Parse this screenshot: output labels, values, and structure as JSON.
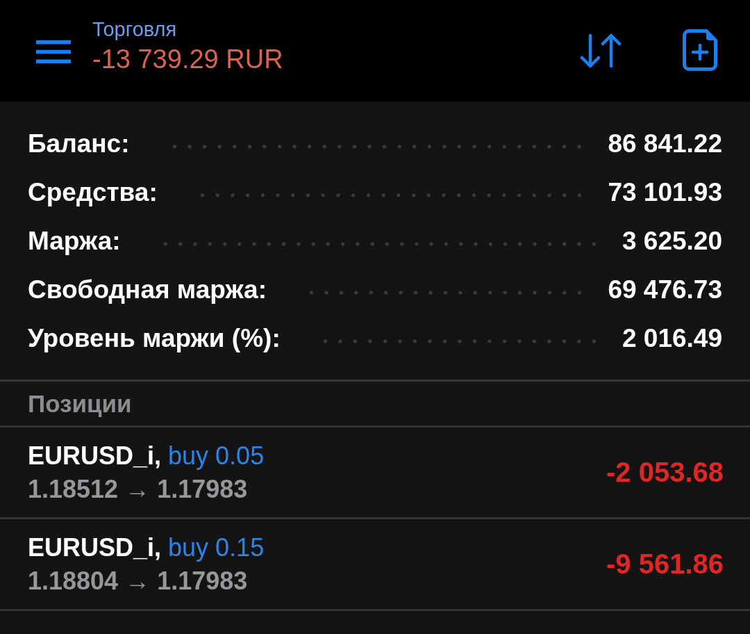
{
  "header": {
    "title": "Торговля",
    "balance": "-13 739.29 RUR",
    "loss": true
  },
  "summary": [
    {
      "label": "Баланс:",
      "value": "86 841.22"
    },
    {
      "label": "Средства:",
      "value": "73 101.93"
    },
    {
      "label": "Маржа:",
      "value": "3 625.20"
    },
    {
      "label": "Свободная маржа:",
      "value": "69 476.73"
    },
    {
      "label": "Уровень маржи (%):",
      "value": "2 016.49"
    }
  ],
  "positions": {
    "title": "Позиции",
    "items": [
      {
        "symbol": "EURUSD_i,",
        "order": "buy 0.05",
        "prices": "1.18512 → 1.17983",
        "profit": "-2 053.68",
        "loss": true
      },
      {
        "symbol": "EURUSD_i,",
        "order": "buy 0.15",
        "prices": "1.18804 → 1.17983",
        "profit": "-9 561.86",
        "loss": true
      }
    ]
  }
}
